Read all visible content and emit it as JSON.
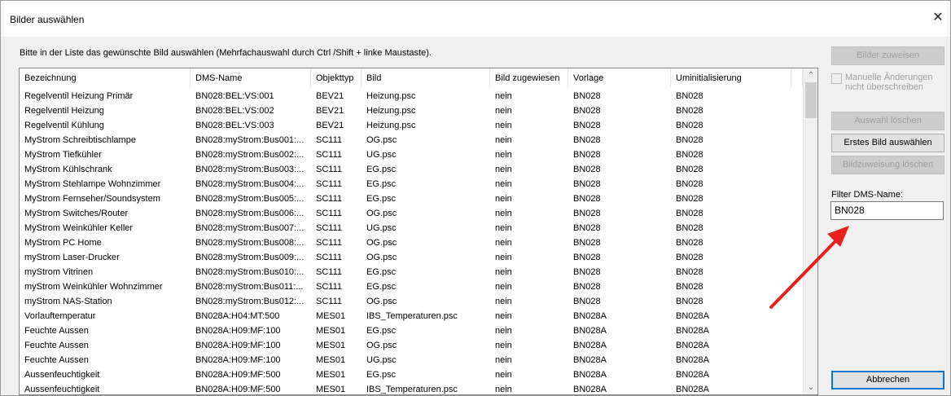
{
  "window": {
    "title": "Bilder auswählen",
    "close_glyph": "✕"
  },
  "instruction": "Bitte in der Liste das gewünschte Bild auswählen (Mehrfachauswahl durch Ctrl /Shift + linke Maustaste).",
  "table": {
    "columns": [
      "Bezeichnung",
      "DMS-Name",
      "Objekttyp",
      "Bild",
      "Bild zugewiesen",
      "Vorlage",
      "Uminitialisierung",
      ""
    ],
    "rows": [
      [
        "Regelventil Heizung Primär",
        "BN028:BEL:VS:001",
        "BEV21",
        "Heizung.psc",
        "nein",
        "BN028",
        "BN028"
      ],
      [
        "Regelventil Heizung",
        "BN028:BEL:VS:002",
        "BEV21",
        "Heizung.psc",
        "nein",
        "BN028",
        "BN028"
      ],
      [
        "Regelventil Kühlung",
        "BN028:BEL:VS:003",
        "BEV21",
        "Heizung.psc",
        "nein",
        "BN028",
        "BN028"
      ],
      [
        "MyStrom Schreibtischlampe",
        "BN028:myStrom:Bus001:...",
        "SC111",
        "OG.psc",
        "nein",
        "BN028",
        "BN028"
      ],
      [
        "MyStrom Tiefkühler",
        "BN028:myStrom:Bus002:...",
        "SC111",
        "UG.psc",
        "nein",
        "BN028",
        "BN028"
      ],
      [
        "MyStrom Kühlschrank",
        "BN028:myStrom:Bus003:...",
        "SC111",
        "EG.psc",
        "nein",
        "BN028",
        "BN028"
      ],
      [
        "MyStrom Stehlampe Wohnzimmer",
        "BN028:myStrom:Bus004:...",
        "SC111",
        "EG.psc",
        "nein",
        "BN028",
        "BN028"
      ],
      [
        "MyStrom Fernseher/Soundsystem",
        "BN028:myStrom:Bus005:...",
        "SC111",
        "EG.psc",
        "nein",
        "BN028",
        "BN028"
      ],
      [
        "MyStrom Switches/Router",
        "BN028:myStrom:Bus006:...",
        "SC111",
        "OG.psc",
        "nein",
        "BN028",
        "BN028"
      ],
      [
        "MyStrom Weinkühler Keller",
        "BN028:myStrom:Bus007:...",
        "SC111",
        "UG.psc",
        "nein",
        "BN028",
        "BN028"
      ],
      [
        "MyStrom PC Home",
        "BN028:myStrom:Bus008:...",
        "SC111",
        "OG.psc",
        "nein",
        "BN028",
        "BN028"
      ],
      [
        "myStrom Laser-Drucker",
        "BN028:myStrom:Bus009:...",
        "SC111",
        "OG.psc",
        "nein",
        "BN028",
        "BN028"
      ],
      [
        "myStrom Vitrinen",
        "BN028:myStrom:Bus010:...",
        "SC111",
        "EG.psc",
        "nein",
        "BN028",
        "BN028"
      ],
      [
        "myStrom Weinkühler Wohnzimmer",
        "BN028:myStrom:Bus011:...",
        "SC111",
        "EG.psc",
        "nein",
        "BN028",
        "BN028"
      ],
      [
        "myStrom NAS-Station",
        "BN028:myStrom:Bus012:...",
        "SC111",
        "OG.psc",
        "nein",
        "BN028",
        "BN028"
      ],
      [
        "Vorlauftemperatur",
        "BN028A:H04:MT:500",
        "MES01",
        "IBS_Temperaturen.psc",
        "nein",
        "BN028A",
        "BN028A"
      ],
      [
        "Feuchte Aussen",
        "BN028A:H09:MF:100",
        "MES01",
        "EG.psc",
        "nein",
        "BN028A",
        "BN028A"
      ],
      [
        "Feuchte Aussen",
        "BN028A:H09:MF:100",
        "MES01",
        "OG.psc",
        "nein",
        "BN028A",
        "BN028A"
      ],
      [
        "Feuchte Aussen",
        "BN028A:H09:MF:100",
        "MES01",
        "UG.psc",
        "nein",
        "BN028A",
        "BN028A"
      ],
      [
        "Aussenfeuchtigkeit",
        "BN028A:H09:MF:500",
        "MES01",
        "EG.psc",
        "nein",
        "BN028A",
        "BN028A"
      ],
      [
        "Aussenfeuchtigkeit",
        "BN028A:H09:MF:500",
        "MES01",
        "IBS_Temperaturen.psc",
        "nein",
        "BN028A",
        "BN028A"
      ]
    ]
  },
  "scrollbar": {
    "up_glyph": "⌃",
    "down_glyph": "⌄"
  },
  "buttons": {
    "assign": "Bilder zuweisen",
    "clear_selection": "Auswahl löschen",
    "select_first": "Erstes Bild auswählen",
    "delete_assignment": "Bildzuweisung löschen",
    "cancel": "Abbrechen"
  },
  "checkbox": {
    "label": "Manuelle Änderungen nicht überschreiben",
    "checked": false
  },
  "filter": {
    "label": "Filter DMS-Name:",
    "value": "BN028"
  },
  "annotation": {
    "arrow_color": "#e8221b"
  }
}
